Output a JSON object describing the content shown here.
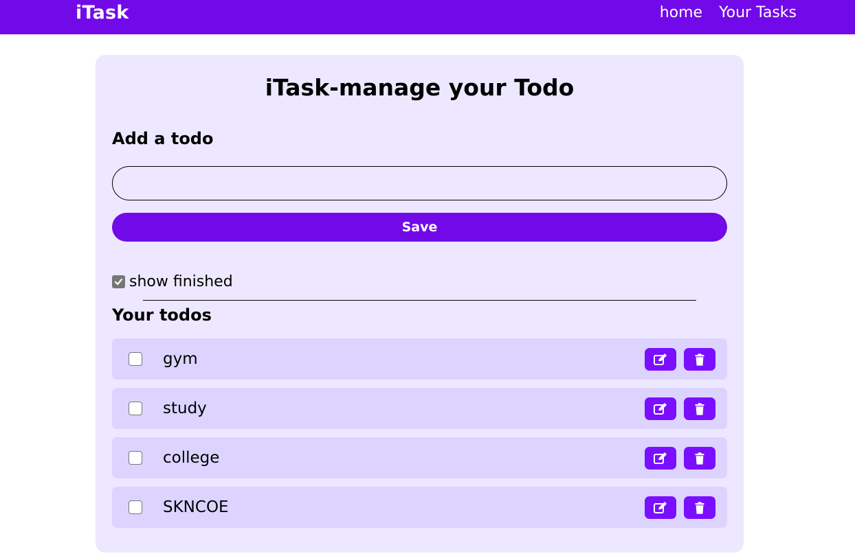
{
  "navbar": {
    "brand": "iTask",
    "links": [
      "home",
      "Your Tasks"
    ]
  },
  "main": {
    "title": "iTask-manage your Todo",
    "add_heading": "Add a todo",
    "input_value": "",
    "save_label": "Save",
    "show_finished_label": "show finished",
    "show_finished_checked": true,
    "todos_heading": "Your todos",
    "todos": [
      {
        "text": "gym",
        "done": false
      },
      {
        "text": "study",
        "done": false
      },
      {
        "text": "college",
        "done": false
      },
      {
        "text": "SKNCOE",
        "done": false
      }
    ]
  },
  "colors": {
    "primary": "#7209e9",
    "card_bg": "#ede8ff",
    "row_bg": "#dcd4ff",
    "action_btn": "#7a0fff"
  },
  "icons": {
    "edit": "edit-icon",
    "delete": "trash-icon",
    "checkbox": "checkmark-icon"
  }
}
